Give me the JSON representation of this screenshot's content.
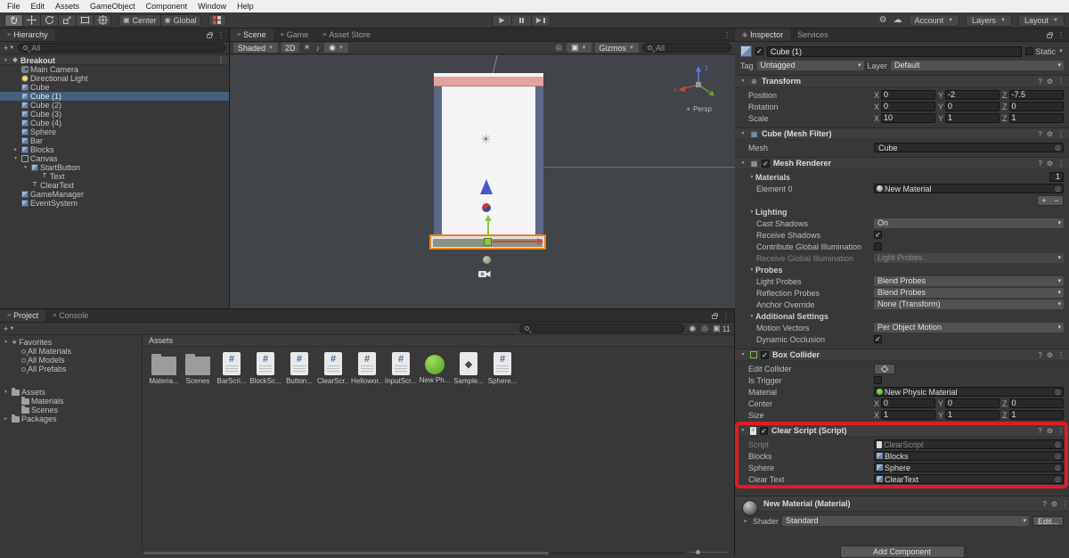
{
  "menubar": {
    "items": [
      "File",
      "Edit",
      "Assets",
      "GameObject",
      "Component",
      "Window",
      "Help"
    ]
  },
  "toolbar": {
    "center": "Center",
    "global": "Global",
    "account": "Account",
    "layers": "Layers",
    "layout": "Layout",
    "tools": [
      "hand",
      "move",
      "rotate",
      "scale",
      "rect",
      "transform"
    ]
  },
  "hierarchy": {
    "tab": "Hierarchy",
    "search_filter": "All",
    "items": [
      {
        "label": "Breakout",
        "indent": 0,
        "type": "scene",
        "arrow": "down",
        "icon": "scene"
      },
      {
        "label": "Main Camera",
        "indent": 1,
        "icon": "camera"
      },
      {
        "label": "Directional Light",
        "indent": 1,
        "icon": "light"
      },
      {
        "label": "Cube",
        "indent": 1,
        "icon": "cube"
      },
      {
        "label": "Cube (1)",
        "indent": 1,
        "icon": "cube",
        "selected": true
      },
      {
        "label": "Cube (2)",
        "indent": 1,
        "icon": "cube"
      },
      {
        "label": "Cube (3)",
        "indent": 1,
        "icon": "cube"
      },
      {
        "label": "Cube (4)",
        "indent": 1,
        "icon": "cube"
      },
      {
        "label": "Sphere",
        "indent": 1,
        "icon": "cube"
      },
      {
        "label": "Bar",
        "indent": 1,
        "icon": "cube"
      },
      {
        "label": "Blocks",
        "indent": 1,
        "icon": "cube",
        "arrow": "right"
      },
      {
        "label": "Canvas",
        "indent": 1,
        "icon": "canvas",
        "arrow": "down"
      },
      {
        "label": "StartButton",
        "indent": 2,
        "icon": "cube",
        "arrow": "down"
      },
      {
        "label": "Text",
        "indent": 3,
        "icon": "text"
      },
      {
        "label": "ClearText",
        "indent": 2,
        "icon": "text"
      },
      {
        "label": "GameManager",
        "indent": 1,
        "icon": "cube"
      },
      {
        "label": "EventSystem",
        "indent": 1,
        "icon": "cube"
      }
    ]
  },
  "scene": {
    "tabs": [
      "Scene",
      "Game",
      "Asset Store"
    ],
    "shaded": "Shaded",
    "d2": "2D",
    "gizmos": "Gizmos",
    "search_filter": "All",
    "persp": "Persp",
    "axis": {
      "x": "x",
      "y": "y",
      "z": "z"
    }
  },
  "project": {
    "tabs": [
      "Project",
      "Console"
    ],
    "path": "Assets",
    "count_badge": "11",
    "tree": [
      {
        "label": "Favorites",
        "indent": 0,
        "arrow": "down",
        "icon": "star"
      },
      {
        "label": "All Materials",
        "indent": 1,
        "icon": "search"
      },
      {
        "label": "All Models",
        "indent": 1,
        "icon": "search"
      },
      {
        "label": "All Prefabs",
        "indent": 1,
        "icon": "search"
      },
      {
        "label": "Assets",
        "indent": 0,
        "arrow": "down",
        "icon": "folder",
        "gap": true
      },
      {
        "label": "Materials",
        "indent": 1,
        "icon": "folder"
      },
      {
        "label": "Scenes",
        "indent": 1,
        "icon": "folder"
      },
      {
        "label": "Packages",
        "indent": 0,
        "arrow": "right",
        "icon": "folder"
      }
    ],
    "grid": [
      {
        "label": "Materia...",
        "icon": "folder"
      },
      {
        "label": "Scenes",
        "icon": "folder"
      },
      {
        "label": "BarScri...",
        "icon": "script"
      },
      {
        "label": "BlockSc...",
        "icon": "script"
      },
      {
        "label": "Button...",
        "icon": "script"
      },
      {
        "label": "ClearScr...",
        "icon": "script"
      },
      {
        "label": "Hellowor...",
        "icon": "script"
      },
      {
        "label": "InputScr...",
        "icon": "script"
      },
      {
        "label": "New Ph...",
        "icon": "physic"
      },
      {
        "label": "Sample...",
        "icon": "scene"
      },
      {
        "label": "Sphere...",
        "icon": "script"
      }
    ]
  },
  "inspector": {
    "tabs": [
      "Inspector",
      "Services"
    ],
    "header": {
      "name": "Cube (1)",
      "static_label": "Static",
      "tag_label": "Tag",
      "tag_value": "Untagged",
      "layer_label": "Layer",
      "layer_value": "Default"
    },
    "components": [
      {
        "title": "Transform",
        "icon": "transform",
        "rows": [
          {
            "type": "vector3",
            "label": "Position",
            "x": "0",
            "y": "-2",
            "z": "-7.5"
          },
          {
            "type": "vector3",
            "label": "Rotation",
            "x": "0",
            "y": "0",
            "z": "0"
          },
          {
            "type": "vector3",
            "label": "Scale",
            "x": "10",
            "y": "1",
            "z": "1"
          }
        ]
      },
      {
        "title": "Cube (Mesh Filter)",
        "icon": "meshfilter",
        "rows": [
          {
            "type": "object",
            "label": "Mesh",
            "value": "Cube",
            "icon": "mesh"
          }
        ]
      },
      {
        "title": "Mesh Renderer",
        "icon": "meshrenderer",
        "checkbox": true,
        "checked": true,
        "rows": [
          {
            "type": "foldout",
            "label": "Materials",
            "right": "1"
          },
          {
            "type": "object",
            "label": "Element 0",
            "value": "New Material",
            "icon": "material",
            "indent": 1
          },
          {
            "type": "plusminus"
          },
          {
            "type": "foldout",
            "label": "Lighting"
          },
          {
            "type": "dropdown",
            "label": "Cast Shadows",
            "value": "On",
            "indent": 1
          },
          {
            "type": "checkbox",
            "label": "Receive Shadows",
            "checked": true,
            "indent": 1
          },
          {
            "type": "checkbox",
            "label": "Contribute Global Illumination",
            "checked": false,
            "indent": 1
          },
          {
            "type": "dropdown",
            "label": "Receive Global Illumination",
            "value": "Light Probes",
            "disabled": true,
            "indent": 1
          },
          {
            "type": "foldout",
            "label": "Probes"
          },
          {
            "type": "dropdown",
            "label": "Light Probes",
            "value": "Blend Probes",
            "indent": 1
          },
          {
            "type": "dropdown",
            "label": "Reflection Probes",
            "value": "Blend Probes",
            "indent": 1
          },
          {
            "type": "dropdown",
            "label": "Anchor Override",
            "value": "None (Transform)",
            "indent": 1
          },
          {
            "type": "foldout",
            "label": "Additional Settings"
          },
          {
            "type": "dropdown",
            "label": "Motion Vectors",
            "value": "Per Object Motion",
            "indent": 1
          },
          {
            "type": "checkbox",
            "label": "Dynamic Occlusion",
            "checked": true,
            "indent": 1
          }
        ]
      },
      {
        "title": "Box Collider",
        "icon": "collider",
        "checkbox": true,
        "checked": true,
        "rows": [
          {
            "type": "editbutton",
            "label": "Edit Collider"
          },
          {
            "type": "checkbox",
            "label": "Is Trigger",
            "checked": false
          },
          {
            "type": "object",
            "label": "Material",
            "value": "New Physic Material",
            "icon": "physic"
          },
          {
            "type": "vector3",
            "label": "Center",
            "x": "0",
            "y": "0",
            "z": "0"
          },
          {
            "type": "vector3",
            "label": "Size",
            "x": "1",
            "y": "1",
            "z": "1"
          }
        ]
      },
      {
        "title": "Clear Script (Script)",
        "icon": "script",
        "checkbox": true,
        "checked": true,
        "rows": [
          {
            "type": "object",
            "label": "Script",
            "value": "ClearScript",
            "icon": "script",
            "disabled": true
          },
          {
            "type": "object",
            "label": "Blocks",
            "value": "Blocks",
            "icon": "gameobject"
          },
          {
            "type": "object",
            "label": "Sphere",
            "value": "Sphere",
            "icon": "gameobject"
          },
          {
            "type": "object",
            "label": "Clear Text",
            "value": "ClearText",
            "icon": "gameobject"
          }
        ]
      }
    ],
    "material": {
      "title": "New Material (Material)",
      "shader_label": "Shader",
      "shader_value": "Standard",
      "edit_label": "Edit..."
    },
    "add_component": "Add Component"
  },
  "colors": {
    "annotation_red": "#E01B24",
    "selection_blue": "#44607E",
    "gizmo_selection_orange": "#F07D1A",
    "panel_bg": "#383838"
  }
}
